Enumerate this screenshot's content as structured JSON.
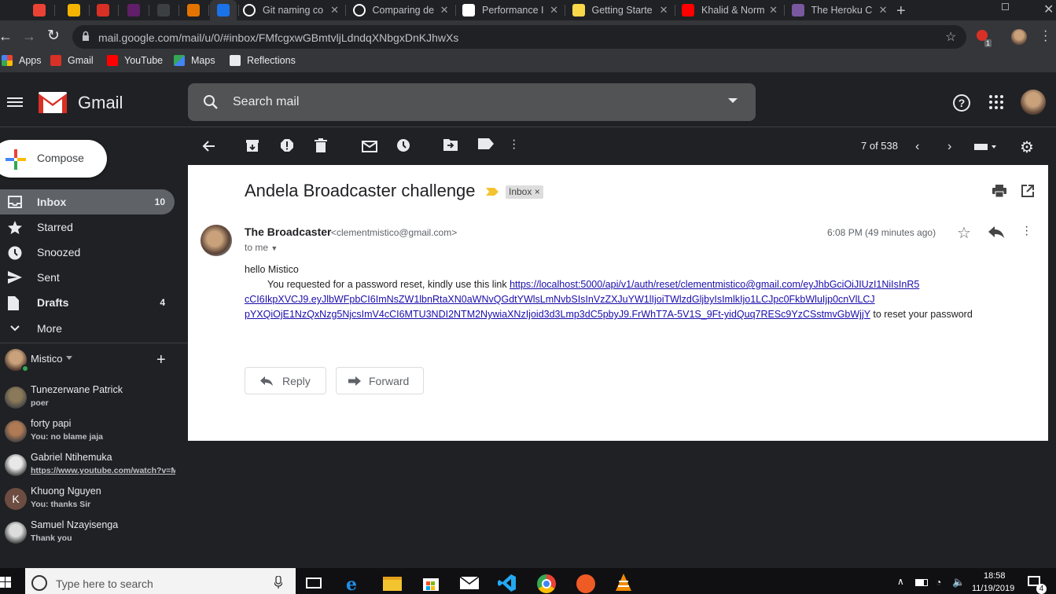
{
  "browser": {
    "tabs": [
      {
        "title": "",
        "icon": "redline-icon",
        "color": "#ea4335"
      },
      {
        "title": "",
        "icon": "owl-icon",
        "color": "#f4b400"
      },
      {
        "title": "",
        "icon": "gmail-icon",
        "color": "#d93025"
      },
      {
        "title": "",
        "icon": "slack-icon",
        "color": "#611f69"
      },
      {
        "title": "",
        "icon": "trend-icon",
        "color": "#3c4043"
      },
      {
        "title": "",
        "icon": "orange-circle-icon",
        "color": "#e37400"
      },
      {
        "title": "",
        "icon": "star-icon",
        "color": "#1a73e8"
      },
      {
        "title": "Git naming co",
        "icon": "github-icon",
        "color": "#ffffff"
      },
      {
        "title": "Comparing de",
        "icon": "github-icon",
        "color": "#ffffff"
      },
      {
        "title": "Performance I",
        "icon": "ex-icon",
        "color": "#ffffff"
      },
      {
        "title": "Getting Starte",
        "icon": "smiley-icon",
        "color": "#f9d849"
      },
      {
        "title": "Khalid & Norm",
        "icon": "youtube-icon",
        "color": "#ff0000"
      },
      {
        "title": "The Heroku C",
        "icon": "heroku-icon",
        "color": "#79589f"
      }
    ],
    "url": "mail.google.com/mail/u/0/#inbox/FMfcgxwGBmtvljLdndqXNbgxDnKJhwXs",
    "bookmarks": [
      {
        "label": "Apps",
        "icon": "apps-icon"
      },
      {
        "label": "Gmail",
        "icon": "gmail-icon"
      },
      {
        "label": "YouTube",
        "icon": "youtube-icon"
      },
      {
        "label": "Maps",
        "icon": "maps-icon"
      },
      {
        "label": "Reflections",
        "icon": "reflections-icon"
      }
    ],
    "extension_badge": "1"
  },
  "gmail": {
    "logo_text": "Gmail",
    "search_placeholder": "Search mail",
    "compose_label": "Compose",
    "nav": [
      {
        "label": "Inbox",
        "count": "10",
        "icon": "inbox-icon",
        "active": true
      },
      {
        "label": "Starred",
        "count": "",
        "icon": "star-icon"
      },
      {
        "label": "Snoozed",
        "count": "",
        "icon": "clock-icon"
      },
      {
        "label": "Sent",
        "count": "",
        "icon": "send-icon"
      },
      {
        "label": "Drafts",
        "count": "4",
        "icon": "draft-icon"
      },
      {
        "label": "More",
        "count": "",
        "icon": "chevron-down-icon"
      }
    ],
    "hangouts_user": "Mistico",
    "chats": [
      {
        "name": "Tunezerwane Patrick",
        "message": "poer",
        "avatar_color": "#8a7a5a"
      },
      {
        "name": "forty papi",
        "message": "You: no blame jaja",
        "avatar_color": "#b07a55"
      },
      {
        "name": "Gabriel Ntihemuka",
        "message": "https://www.youtube.com/watch?v=MC",
        "avatar_color": "#e8e8e8",
        "link": true
      },
      {
        "name": "Khuong Nguyen",
        "message": "You: thanks Sir",
        "avatar_color": "#6d4c41",
        "initial": "K"
      },
      {
        "name": "Samuel Nzayisenga",
        "message": "Thank you",
        "avatar_color": "#dcdcdc"
      }
    ],
    "pagination": "7 of 538",
    "message": {
      "subject": "Andela Broadcaster challenge",
      "label": "Inbox",
      "sender_name": "The Broadcaster",
      "sender_email": "<clementmistico@gmail.com>",
      "to": "to me",
      "time": "6:08 PM (49 minutes ago)",
      "greeting": "hello Mistico",
      "body_prefix": "You requested for a password reset, kindly use this link",
      "link_line1": "https://localhost:5000/api/v1/auth/reset/clementmistico@gmail.com/eyJhbGciOiJIUzI1NiIsInR5",
      "link_line2": "cCI6IkpXVCJ9.eyJlbWFpbCI6ImNsZW1lbnRtaXN0aWNvQGdtYWlsLmNvbSIsInVzZXJuYW1lIjoiTWlzdGljbyIsImlkIjo1LCJpc0FkbWluIjp0cnVlLCJ",
      "link_line3": "pYXQiOjE1NzQxNzg5NjcsImV4cCI6MTU3NDI2NTM2NywiaXNzIjoid3d3Lmp3dC5pbyJ9.FrWhT7A-5V1S_9Ft-yidQuq7RESc9YzCSstmvGbWjjY",
      "body_suffix": "to reset your password",
      "reply_label": "Reply",
      "forward_label": "Forward"
    }
  },
  "taskbar": {
    "search_placeholder": "Type here to search",
    "time": "18:58",
    "date": "11/19/2019",
    "notification_count": "4"
  }
}
